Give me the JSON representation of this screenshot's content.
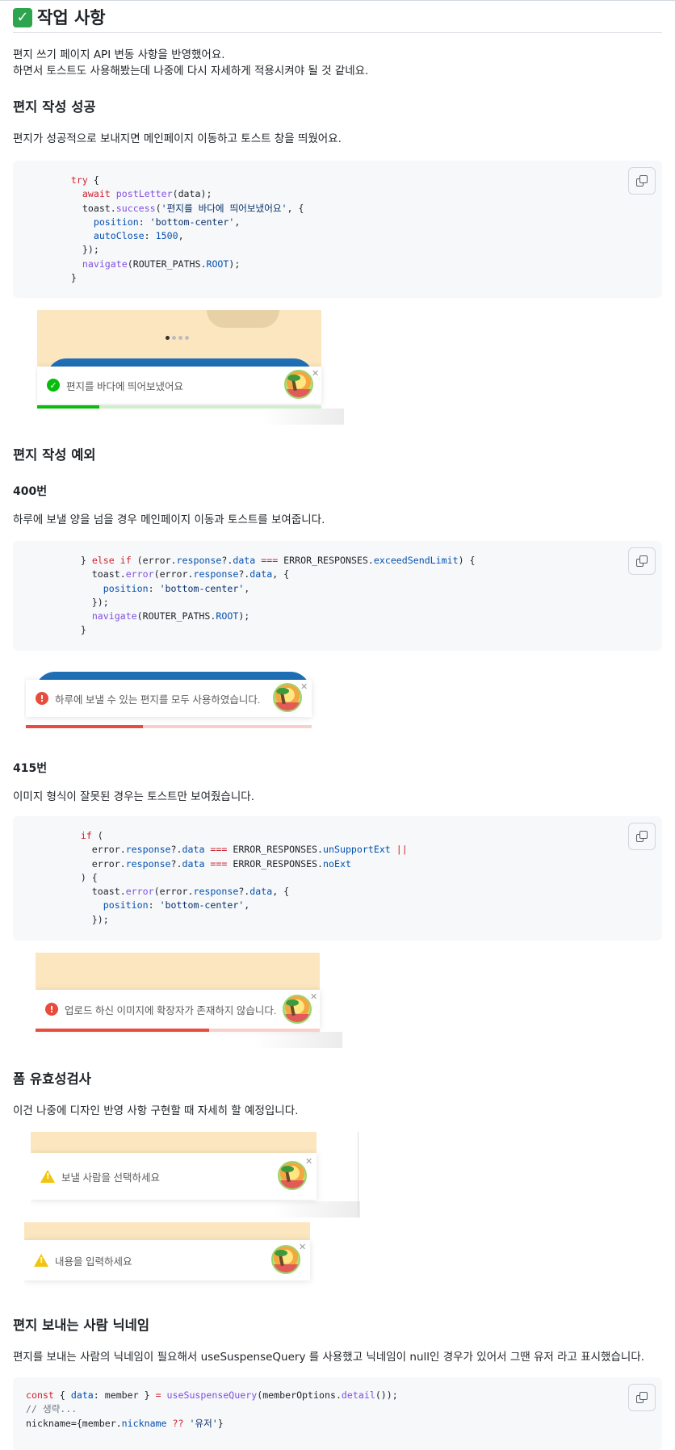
{
  "section": {
    "title": "작업 사항",
    "intro_line1": "편지 쓰기 페이지 API 변동 사항을 반영했어요.",
    "intro_line2": "하면서 토스트도 사용해봤는데 나중에 다시 자세하게 적용시켜야 될 것 같네요."
  },
  "success": {
    "heading": "편지 작성 성공",
    "desc": "편지가 성공적으로 보내지면 메인페이지 이동하고 토스트 창을 띄웠어요.",
    "toast_text": "편지를 바다에 띄어보냈어요",
    "progress_fraction": 0.22
  },
  "error": {
    "heading": "편지 작성 예외",
    "case400": {
      "heading": "400번",
      "desc": "하루에 보낼 양을 넘을 경우 메인페이지 이동과 토스트를 보여줍니다.",
      "toast_text": "하루에 보낼 수 있는 편지를 모두 사용하였습니다.",
      "progress_fraction": 0.41
    },
    "case415": {
      "heading": "415번",
      "desc": "이미지 형식이 잘못된 경우는 토스트만 보여줬습니다.",
      "toast_text": "업로드 하신 이미지에 확장자가 존재하지 않습니다.",
      "progress_fraction": 0.61
    }
  },
  "validation": {
    "heading": "폼 유효성검사",
    "desc": "이건 나중에 디자인 반영 사항 구현할 때 자세히 할 예정입니다.",
    "toast1_text": "보낼 사람을 선택하세요",
    "toast2_text": "내용을 입력하세요"
  },
  "nickname": {
    "heading": "편지 보내는 사람 닉네임",
    "desc": "편지를 보내는 사람의 닉네임이 필요해서 useSuspenseQuery 를 사용했고 닉네임이 null인 경우가 있어서 그땐 유저 라고 표시했습니다."
  },
  "colors": {
    "success_green": "#07bc0c",
    "error_red": "#e74c3c",
    "warning_yellow": "#f1c40f",
    "sand": "#fbe6bf",
    "brand_blue": "#1f6fb7"
  },
  "icons": [
    "check-mark-icon",
    "copy-icon",
    "success-check-icon",
    "error-icon",
    "warning-icon",
    "avatar-icon",
    "close-icon"
  ]
}
